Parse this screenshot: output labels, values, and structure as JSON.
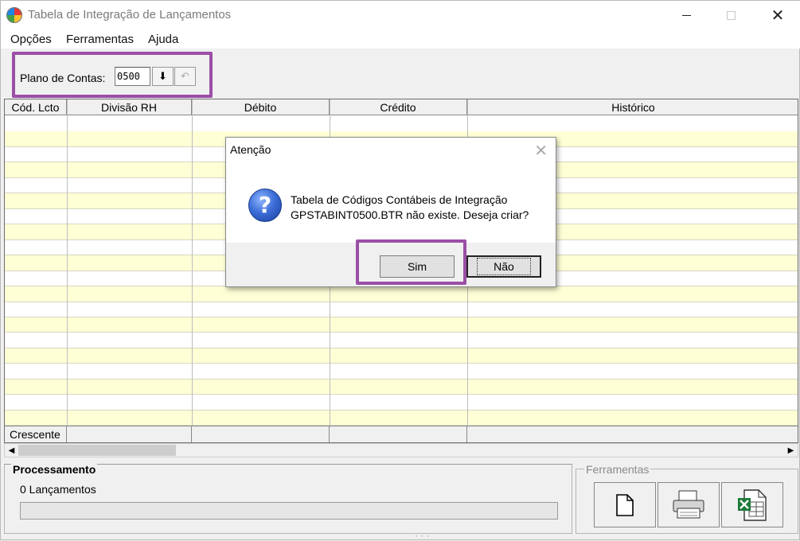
{
  "window": {
    "title": "Tabela de Integração de Lançamentos",
    "icon": "app-logo-icon"
  },
  "menu": [
    "Opções",
    "Ferramentas",
    "Ajuda"
  ],
  "toolbar": {
    "plano_label": "Plano de Contas:",
    "plano_value": "0500",
    "btn1_icon": "download-icon",
    "btn2_icon": "undo-icon"
  },
  "grid": {
    "columns": [
      "Cód. Lcto",
      "Divisão RH",
      "Débito",
      "Crédito",
      "Histórico"
    ],
    "footer": [
      "Crescente",
      "",
      "",
      "",
      ""
    ]
  },
  "processamento": {
    "title": "Processamento",
    "count": "0 Lançamentos",
    "progress": 0
  },
  "ferramentas": {
    "title": "Ferramentas",
    "buttons": [
      "new-document-icon",
      "printer-icon",
      "excel-export-icon"
    ]
  },
  "dialog": {
    "title": "Atenção",
    "line1": "Tabela de Códigos Contábeis de Integração",
    "line2": "GPSTABINT0500.BTR não existe. Deseja criar?",
    "yes": "Sim",
    "no": "Não",
    "icon": "question-icon"
  },
  "colors": {
    "highlight": "#9b4fa6",
    "row_alt": "#ffffd6"
  }
}
